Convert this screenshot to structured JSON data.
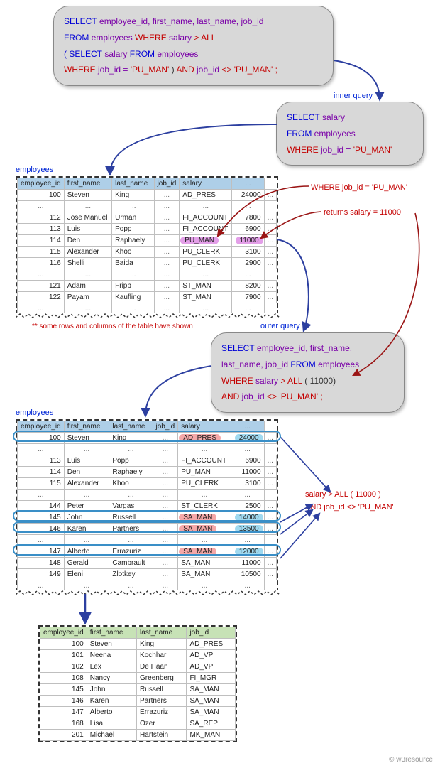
{
  "footer": "© w3resource",
  "main_query": {
    "l1a": "SELECT",
    "l1b": " employee_id, first_name, last_name, job_id",
    "l2a": "FROM",
    "l2b": " employees  ",
    "l2c": "WHERE",
    "l2d": " salary ",
    "l2e": "> ALL",
    "l3a": "( SELECT",
    "l3b": " salary  ",
    "l3c": "FROM",
    "l3d": " employees",
    "l4a": "WHERE",
    "l4b": " job_id = ",
    "l4c": "'PU_MAN'",
    "l4d": " )  ",
    "l4e": "AND",
    "l4f": " job_id ",
    "l4g": "<>",
    "l4h": " 'PU_MAN' ;"
  },
  "inner_label": "inner query",
  "inner_query": {
    "l1a": "SELECT",
    "l1b": " salary",
    "l2a": "FROM",
    "l2b": " employees",
    "l3a": "WHERE",
    "l3b": " job_id = ",
    "l3c": "'PU_MAN'"
  },
  "annot_where": "WHERE job_id = 'PU_MAN'",
  "annot_returns": "returns salary = 11000",
  "note_rows": "** some rows and columns of the table have shown",
  "outer_label": "outer query",
  "outer_query": {
    "l1a": "SELECT",
    "l1b": " employee_id, first_name,",
    "l2a": "last_name, job_id  ",
    "l2b": "FROM",
    "l2c": " employees",
    "l3a": "WHERE",
    "l3b": " salary ",
    "l3c": "> ALL",
    "l3d": " ( 11000)",
    "l4a": "AND",
    "l4b": " job_id ",
    "l4c": "<>",
    "l4d": " 'PU_MAN' ;"
  },
  "cond_text": {
    "a": "salary > ALL ( 11000 )",
    "b": "AND job_id <> 'PU_MAN'"
  },
  "t_caption": "employees",
  "headers5": [
    "employee_id",
    "first_name",
    "last_name",
    "job_id",
    "salary"
  ],
  "headers4": [
    "employee_id",
    "first_name",
    "last_name",
    "job_id"
  ],
  "table1": [
    {
      "id": "100",
      "fn": "Steven",
      "ln": "King",
      "job": "AD_PRES",
      "sal": "24000"
    },
    {
      "el": true
    },
    {
      "id": "112",
      "fn": "Jose Manuel",
      "ln": "Urman",
      "job": "FI_ACCOUNT",
      "sal": "7800"
    },
    {
      "id": "113",
      "fn": "Luis",
      "ln": "Popp",
      "job": "FI_ACCOUNT",
      "sal": "6900"
    },
    {
      "id": "114",
      "fn": "Den",
      "ln": "Raphaely",
      "job": "PU_MAN",
      "sal": "11000",
      "hl": "mag"
    },
    {
      "id": "115",
      "fn": "Alexander",
      "ln": "Khoo",
      "job": "PU_CLERK",
      "sal": "3100"
    },
    {
      "id": "116",
      "fn": "Shelli",
      "ln": "Baida",
      "job": "PU_CLERK",
      "sal": "2900"
    },
    {
      "el": true
    },
    {
      "id": "121",
      "fn": "Adam",
      "ln": "Fripp",
      "job": "ST_MAN",
      "sal": "8200"
    },
    {
      "id": "122",
      "fn": "Payam",
      "ln": "Kaufling",
      "job": "ST_MAN",
      "sal": "7900"
    },
    {
      "el": true
    }
  ],
  "table2": [
    {
      "id": "100",
      "fn": "Steven",
      "ln": "King",
      "job": "AD_PRES",
      "sal": "24000",
      "hl": "red",
      "mark": true
    },
    {
      "el": true
    },
    {
      "id": "113",
      "fn": "Luis",
      "ln": "Popp",
      "job": "FI_ACCOUNT",
      "sal": "6900"
    },
    {
      "id": "114",
      "fn": "Den",
      "ln": "Raphaely",
      "job": "PU_MAN",
      "sal": "11000"
    },
    {
      "id": "115",
      "fn": "Alexander",
      "ln": "Khoo",
      "job": "PU_CLERK",
      "sal": "3100"
    },
    {
      "el": true
    },
    {
      "id": "144",
      "fn": "Peter",
      "ln": "Vargas",
      "job": "ST_CLERK",
      "sal": "2500"
    },
    {
      "id": "145",
      "fn": "John",
      "ln": "Russell",
      "job": "SA_MAN",
      "sal": "14000",
      "hl": "red",
      "mark": true
    },
    {
      "id": "146",
      "fn": "Karen",
      "ln": "Partners",
      "job": "SA_MAN",
      "sal": "13500",
      "hl": "red",
      "mark": true
    },
    {
      "el": true
    },
    {
      "id": "147",
      "fn": "Alberto",
      "ln": "Errazuriz",
      "job": "SA_MAN",
      "sal": "12000",
      "hl": "red",
      "mark": true
    },
    {
      "id": "148",
      "fn": "Gerald",
      "ln": "Cambrault",
      "job": "SA_MAN",
      "sal": "11000"
    },
    {
      "id": "149",
      "fn": "Eleni",
      "ln": "Zlotkey",
      "job": "SA_MAN",
      "sal": "10500"
    },
    {
      "el": true
    }
  ],
  "table3": [
    {
      "id": "100",
      "fn": "Steven",
      "ln": "King",
      "job": "AD_PRES"
    },
    {
      "id": "101",
      "fn": "Neena",
      "ln": "Kochhar",
      "job": "AD_VP"
    },
    {
      "id": "102",
      "fn": "Lex",
      "ln": "De Haan",
      "job": "AD_VP"
    },
    {
      "id": "108",
      "fn": "Nancy",
      "ln": "Greenberg",
      "job": "FI_MGR"
    },
    {
      "id": "145",
      "fn": "John",
      "ln": "Russell",
      "job": "SA_MAN"
    },
    {
      "id": "146",
      "fn": "Karen",
      "ln": "Partners",
      "job": "SA_MAN"
    },
    {
      "id": "147",
      "fn": "Alberto",
      "ln": "Errazuriz",
      "job": "SA_MAN"
    },
    {
      "id": "168",
      "fn": "Lisa",
      "ln": "Ozer",
      "job": "SA_REP"
    },
    {
      "id": "201",
      "fn": "Michael",
      "ln": "Hartstein",
      "job": "MK_MAN"
    }
  ]
}
